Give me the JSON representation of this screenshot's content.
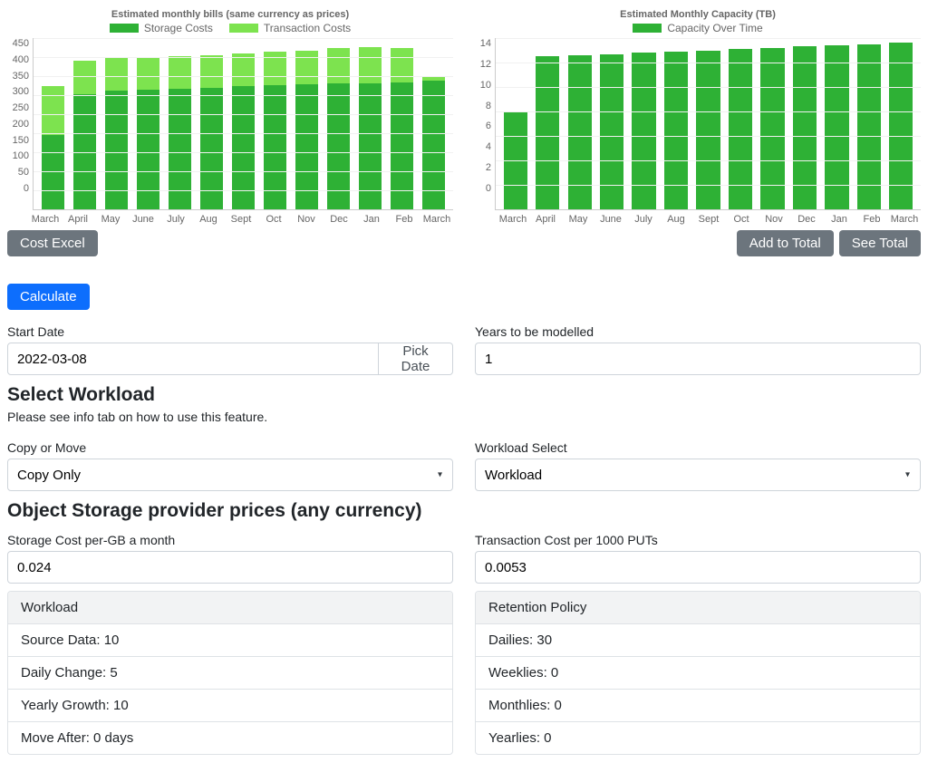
{
  "chart_data": [
    {
      "type": "bar",
      "title": "Estimated monthly bills (same currency as prices)",
      "categories": [
        "March",
        "April",
        "May",
        "June",
        "July",
        "Aug",
        "Sept",
        "Oct",
        "Nov",
        "Dec",
        "Jan",
        "Feb",
        "March"
      ],
      "series": [
        {
          "name": "Storage Costs",
          "color": "#2eb135",
          "values": [
            195,
            302,
            311,
            314,
            317,
            320,
            323,
            326,
            328,
            330,
            332,
            334,
            337
          ]
        },
        {
          "name": "Transaction Costs",
          "color": "#7de34f",
          "values": [
            128,
            88,
            86,
            86,
            86,
            86,
            87,
            88,
            89,
            93,
            94,
            89,
            10
          ]
        }
      ],
      "ylim": [
        0,
        450
      ],
      "ystep": 50,
      "xlabel": "",
      "ylabel": ""
    },
    {
      "type": "bar",
      "title": "Estimated Monthly Capacity (TB)",
      "categories": [
        "March",
        "April",
        "May",
        "June",
        "July",
        "Aug",
        "Sept",
        "Oct",
        "Nov",
        "Dec",
        "Jan",
        "Feb",
        "March"
      ],
      "series": [
        {
          "name": "Capacity Over Time",
          "color": "#2eb135",
          "values": [
            8.0,
            12.5,
            12.6,
            12.7,
            12.8,
            12.9,
            13.0,
            13.1,
            13.2,
            13.3,
            13.4,
            13.5,
            13.6
          ]
        }
      ],
      "ylim": [
        0,
        14
      ],
      "ystep": 2,
      "xlabel": "",
      "ylabel": ""
    }
  ],
  "buttons": {
    "cost_excel": "Cost Excel",
    "add_to_total": "Add to Total",
    "see_total": "See Total",
    "calculate": "Calculate",
    "pick_date": "Pick Date"
  },
  "form": {
    "start_date_label": "Start Date",
    "start_date_value": "2022-03-08",
    "years_label": "Years to be modelled",
    "years_value": "1",
    "select_workload_heading": "Select Workload",
    "select_workload_sub": "Please see info tab on how to use this feature.",
    "copy_move_label": "Copy or Move",
    "copy_move_value": "Copy Only",
    "workload_select_label": "Workload Select",
    "workload_select_value": "Workload",
    "prices_heading": "Object Storage provider prices (any currency)",
    "storage_cost_label": "Storage Cost per-GB a month",
    "storage_cost_value": "0.024",
    "txn_cost_label": "Transaction Cost per 1000 PUTs",
    "txn_cost_value": "0.0053"
  },
  "workload_panel": {
    "header": "Workload",
    "items": [
      "Source Data: 10",
      "Daily Change: 5",
      "Yearly Growth: 10",
      "Move After: 0 days"
    ]
  },
  "retention_panel": {
    "header": "Retention Policy",
    "items": [
      "Dailies: 30",
      "Weeklies: 0",
      "Monthlies: 0",
      "Yearlies: 0"
    ]
  }
}
